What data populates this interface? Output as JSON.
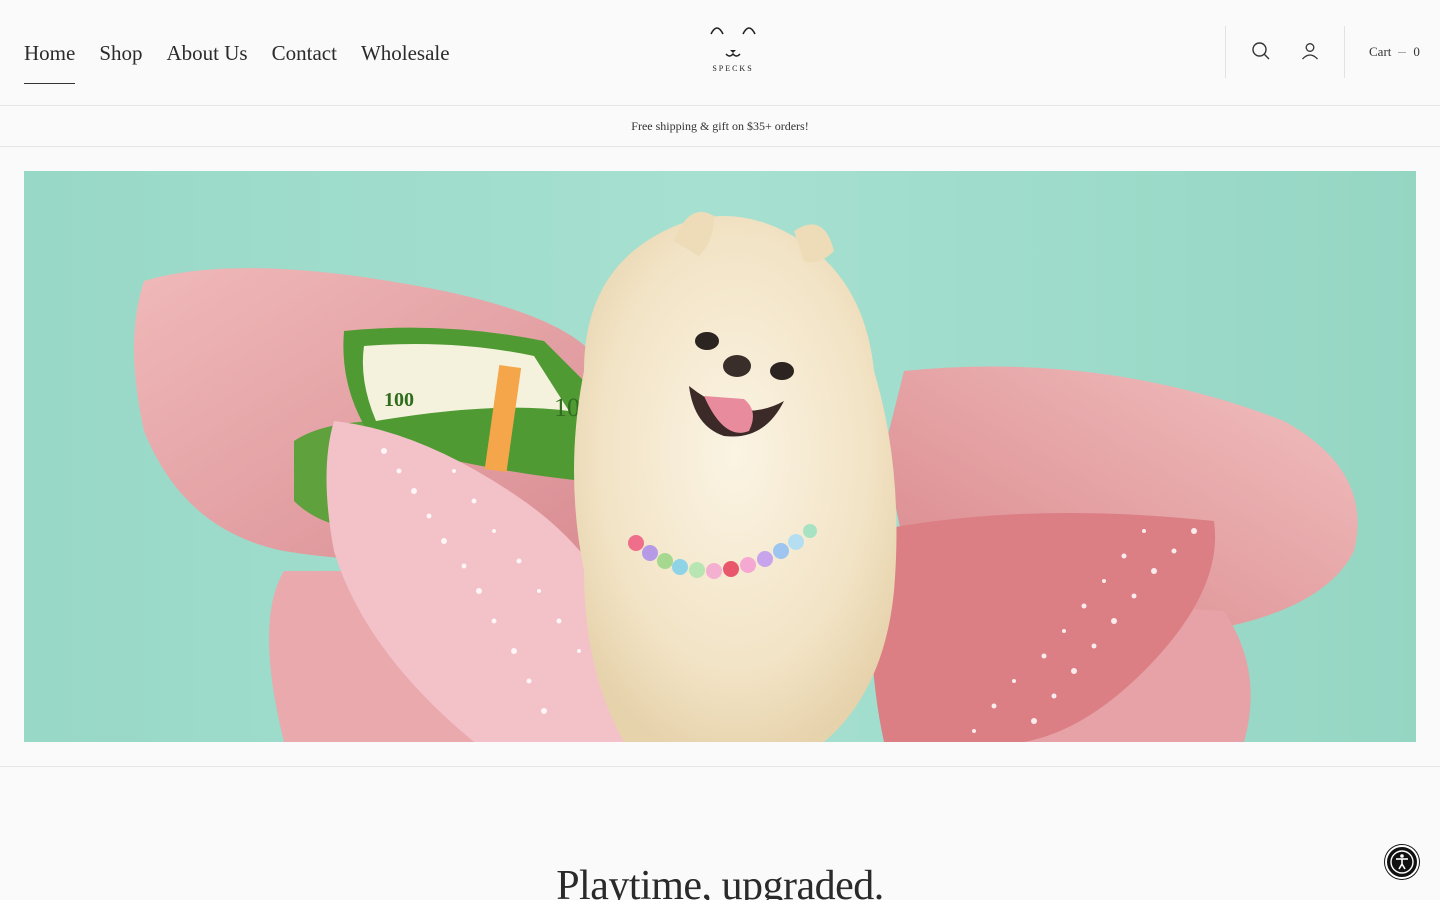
{
  "header": {
    "nav": [
      {
        "label": "Home",
        "active": true
      },
      {
        "label": "Shop",
        "active": false
      },
      {
        "label": "About Us",
        "active": false
      },
      {
        "label": "Contact",
        "active": false
      },
      {
        "label": "Wholesale",
        "active": false
      }
    ],
    "logo_text": "SPECKS",
    "search_icon": "search-icon",
    "account_icon": "account-icon",
    "cart_label": "Cart",
    "cart_count": "0"
  },
  "announcement": "Free shipping & gift on $35+ orders!",
  "hero": {
    "image": "hero-image",
    "colors": {
      "background": "#9fdccb",
      "chair": "#e8a3a6",
      "dog": "#f3e7cf"
    }
  },
  "section": {
    "title": "Playtime, upgraded."
  },
  "accessibility_icon": "accessibility-icon"
}
